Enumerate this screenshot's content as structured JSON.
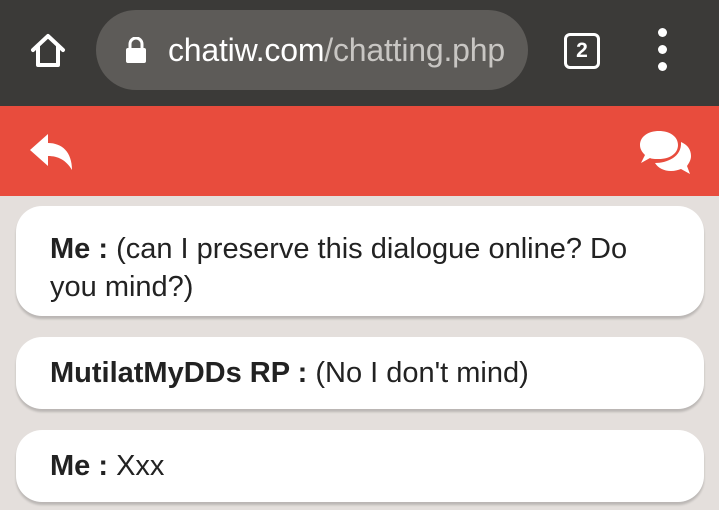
{
  "browser": {
    "url_domain": "chatiw.com",
    "url_path": "/chatting.php",
    "tab_count": "2"
  },
  "icons": {
    "home": "home-icon",
    "lock": "lock-icon",
    "tabs": "tab-count-icon",
    "menu": "more-vert-icon",
    "back": "reply-back-icon",
    "chat": "chat-bubbles-icon"
  },
  "colors": {
    "chrome_bg": "#3b3a38",
    "url_pill": "#5d5b58",
    "header_red": "#e84c3d",
    "page_bg": "#e4dfdc",
    "bubble_bg": "#ffffff"
  },
  "messages": [
    {
      "author": "Me",
      "separator": " : ",
      "text": "(can I preserve this dialogue online? Do you mind?)"
    },
    {
      "author": "MutilatMyDDs RP",
      "separator": " : ",
      "text": "(No I don't mind)"
    },
    {
      "author": "Me",
      "separator": " : ",
      "text": "Xxx"
    }
  ]
}
